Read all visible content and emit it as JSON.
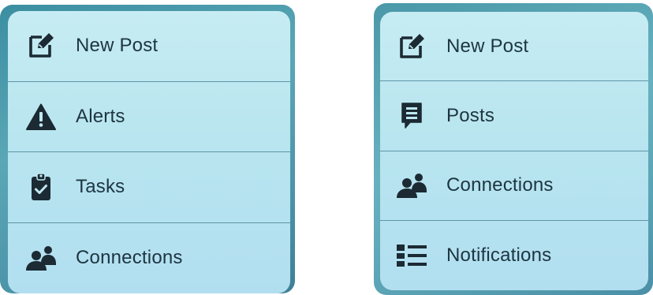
{
  "left_menu": {
    "items": [
      {
        "label": "New Post",
        "icon": "edit-icon"
      },
      {
        "label": "Alerts",
        "icon": "warning-icon"
      },
      {
        "label": "Tasks",
        "icon": "clipboard-check-icon"
      },
      {
        "label": "Connections",
        "icon": "people-icon"
      }
    ]
  },
  "right_menu": {
    "items": [
      {
        "label": "New Post",
        "icon": "edit-icon"
      },
      {
        "label": "Posts",
        "icon": "message-list-icon"
      },
      {
        "label": "Connections",
        "icon": "people-icon"
      },
      {
        "label": "Notifications",
        "icon": "list-icon"
      }
    ]
  },
  "colors": {
    "icon": "#1b2a33",
    "text": "#1d3540",
    "menu_background": "#bfe8f1",
    "divider": "#5f96a8"
  }
}
